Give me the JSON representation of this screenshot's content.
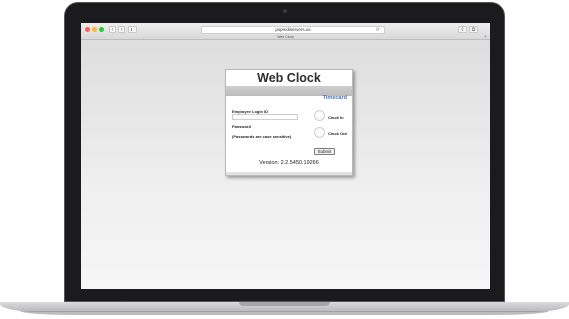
{
  "browser": {
    "address": "pspmdiservers.us",
    "tab_title": "Web Clock",
    "nav_back": "‹",
    "nav_forward": "›",
    "reload_icon": "⟳",
    "share_icon": "⇪",
    "tabs_icon": "⧉",
    "new_tab_icon": "+"
  },
  "card": {
    "title": "Web Clock",
    "timecard_link": "Timecard",
    "login_label": "Employee Login ID",
    "password_label": "Password",
    "case_note": "(Passwords are case sensitive)",
    "clock_in_label": "Clock In",
    "clock_out_label": "Clock Out",
    "submit_label": "Submit",
    "version": "Version: 2.2.5450.19266"
  },
  "colors": {
    "traffic_red": "#fc5f57",
    "traffic_yellow": "#fdbc2e",
    "traffic_green": "#28c840",
    "link_blue": "#4a6fc7"
  }
}
